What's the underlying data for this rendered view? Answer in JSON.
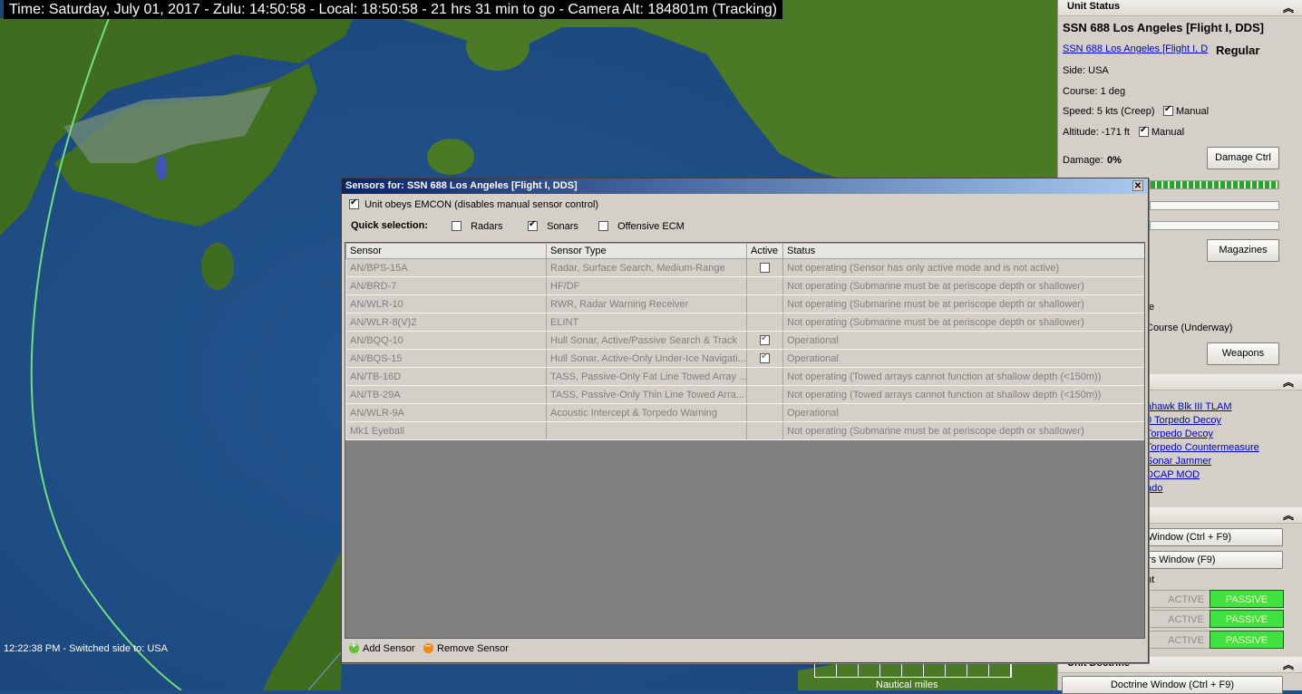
{
  "map": {
    "time_bar": "Time: Saturday, July 01, 2017 - Zulu: 14:50:58 - Local: 18:50:58 - 21 hrs 31 min to go -  Camera Alt: 184801m (Tracking)",
    "log_message": "12:22:38 PM - Switched side to: USA",
    "scale_label": "Nautical miles"
  },
  "panel": {
    "unit_status_header": "Unit Status",
    "unit_name": "SSN 688 Los Angeles [Flight I, DDS]",
    "unit_link": "SSN 688 Los Angeles [Flight I, D",
    "proficiency": "Regular",
    "side": "Side: USA",
    "course": "Course: 1 deg",
    "speed": "Speed: 5 kts (Creep)",
    "speed_manual": "Manual",
    "altitude": "Altitude: -171 ft",
    "altitude_manual": "Manual",
    "damage_label": "Damage:",
    "damage_value": "0%",
    "damage_ctrl_btn": "Damage Ctrl",
    "magazines_btn": "Magazines",
    "partial_e": "e",
    "course_underway": "Course (Underway)",
    "weapons_btn": "Weapons",
    "weapons": [
      "ahawk Blk III TLAM",
      "0 Torpedo Decoy",
      " Torpedo Decoy",
      " Torpedo Countermeasure",
      " Sonar Jammer",
      "DCAP MOD",
      "ado"
    ],
    "window_btn_1": "Window (Ctrl + F9)",
    "window_btn_2": "rs Window (F9)",
    "partial_nt": "nt",
    "modes": [
      {
        "active": "ACTIVE",
        "passive": "PASSIVE"
      },
      {
        "active": "ACTIVE",
        "passive": "PASSIVE"
      },
      {
        "active": "ACTIVE",
        "passive": "PASSIVE"
      }
    ],
    "doctrine_header": "Unit Doctrine",
    "doctrine_btn": "Doctrine Window (Ctrl + F9)",
    "colors": {
      "passive_on": "#3fe23f",
      "panel_bg": "#d4d0c8"
    }
  },
  "dialog": {
    "title": "Sensors for: SSN 688 Los Angeles [Flight I, DDS]",
    "emcon_label": "Unit obeys EMCON (disables manual sensor control)",
    "emcon_checked": true,
    "quick_label": "Quick selection:",
    "quick": [
      {
        "label": "Radars",
        "checked": false
      },
      {
        "label": "Sonars",
        "checked": true
      },
      {
        "label": "Offensive ECM",
        "checked": false
      }
    ],
    "columns": [
      "Sensor",
      "Sensor Type",
      "Active",
      "Status"
    ],
    "rows": [
      {
        "sensor": "AN/BPS-15A",
        "type": "Radar, Surface Search, Medium-Range",
        "active": "off",
        "status": "Not operating (Sensor has only active mode and is not active)"
      },
      {
        "sensor": "AN/BRD-7",
        "type": "HF/DF",
        "active": "none",
        "status": "Not operating (Submarine must be at periscope depth or shallower)"
      },
      {
        "sensor": "AN/WLR-10",
        "type": "RWR, Radar Warning Receiver",
        "active": "none",
        "status": "Not operating (Submarine must be at periscope depth or shallower)"
      },
      {
        "sensor": "AN/WLR-8(V)2",
        "type": "ELINT",
        "active": "none",
        "status": "Not operating (Submarine must be at periscope depth or shallower)"
      },
      {
        "sensor": "AN/BQQ-10",
        "type": "Hull Sonar, Active/Passive Search & Track",
        "active": "on",
        "status": "Operational"
      },
      {
        "sensor": "AN/BQS-15",
        "type": "Hull Sonar, Active-Only Under-Ice Navigati...",
        "active": "on",
        "status": "Operational"
      },
      {
        "sensor": "AN/TB-16D",
        "type": "TASS, Passive-Only Fat Line Towed Array ...",
        "active": "none",
        "status": "Not operating (Towed arrays cannot function at shallow depth (<150m))"
      },
      {
        "sensor": "AN/TB-29A",
        "type": "TASS, Passive-Only Thin Line Towed Arra...",
        "active": "none",
        "status": "Not operating (Towed arrays cannot function at shallow depth (<150m))"
      },
      {
        "sensor": "AN/WLR-9A",
        "type": "Acoustic Intercept & Torpedo Warning",
        "active": "none",
        "status": "Operational"
      },
      {
        "sensor": "Mk1 Eyeball",
        "type": "",
        "active": "none",
        "status": "Not operating (Submarine must be at periscope depth or shallower)"
      }
    ],
    "add_sensor": "Add Sensor",
    "remove_sensor": "Remove Sensor"
  }
}
